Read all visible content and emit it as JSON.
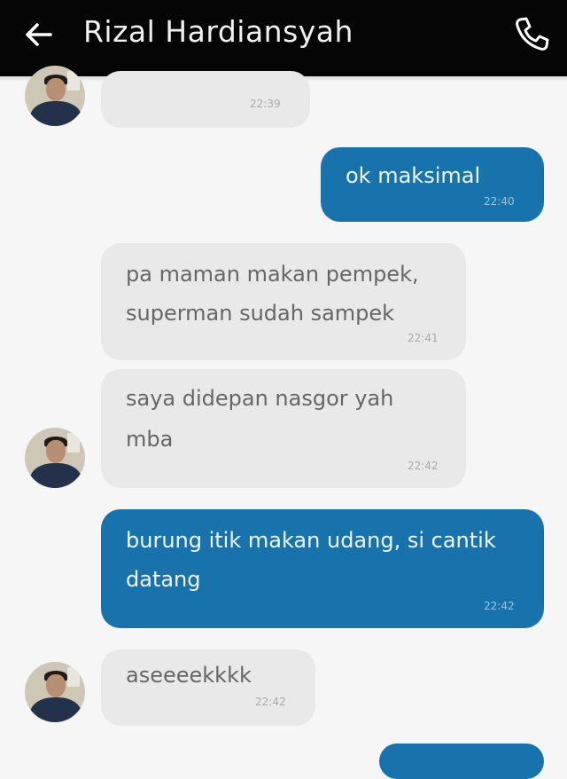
{
  "header": {
    "title": "Rizal Hardiansyah",
    "back_icon": "arrow-left-icon",
    "call_icon": "phone-icon",
    "background": "#050505"
  },
  "messages": [
    {
      "side": "in",
      "lines": [],
      "time": "22:39"
    },
    {
      "side": "out",
      "lines": [
        "ok maksimal"
      ],
      "time": "22:40"
    },
    {
      "side": "in",
      "lines": [
        "pa maman makan pempek,",
        "superman sudah sampek"
      ],
      "time": "22:41"
    },
    {
      "side": "in",
      "lines": [
        "saya didepan nasgor yah",
        "mba"
      ],
      "time": "22:42"
    },
    {
      "side": "out",
      "lines": [
        "burung itik makan udang, si cantik",
        "datang"
      ],
      "time": "22:42"
    },
    {
      "side": "in",
      "lines": [
        "aseeeekkkk"
      ],
      "time": "22:42"
    },
    {
      "side": "out",
      "lines": [],
      "time": ""
    }
  ],
  "colors": {
    "incoming_bubble": "#e9e9e9",
    "outgoing_bubble": "#1873ad"
  }
}
